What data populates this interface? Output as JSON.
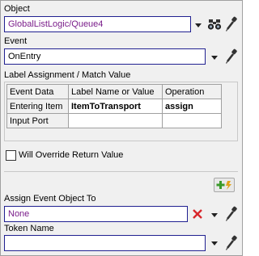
{
  "object": {
    "label": "Object",
    "value": "GlobalListLogic/Queue4"
  },
  "event": {
    "label": "Event",
    "value": "OnEntry"
  },
  "label_assignment": {
    "title": "Label Assignment / Match Value",
    "columns": [
      "Event Data",
      "Label Name or Value",
      "Operation"
    ],
    "rows": [
      {
        "event_data": "Entering Item",
        "label": "ItemToTransport",
        "operation": "assign"
      },
      {
        "event_data": "Input Port",
        "label": "",
        "operation": ""
      }
    ]
  },
  "override": {
    "label": "Will Override Return Value",
    "checked": false
  },
  "assign_event_object": {
    "label": "Assign Event Object To",
    "value": "None"
  },
  "token_name": {
    "label": "Token Name",
    "value": ""
  },
  "icons": {
    "dropdown": "chevron-down-icon",
    "binoculars": "binoculars-icon",
    "eyedropper": "eyedropper-icon",
    "clear": "red-x-icon",
    "add": "green-plus-lightning-icon"
  },
  "colors": {
    "field_border": "#202090",
    "path_text": "#7a1d8a",
    "clear_red": "#d8262b",
    "add_green": "#3a9a2a"
  }
}
